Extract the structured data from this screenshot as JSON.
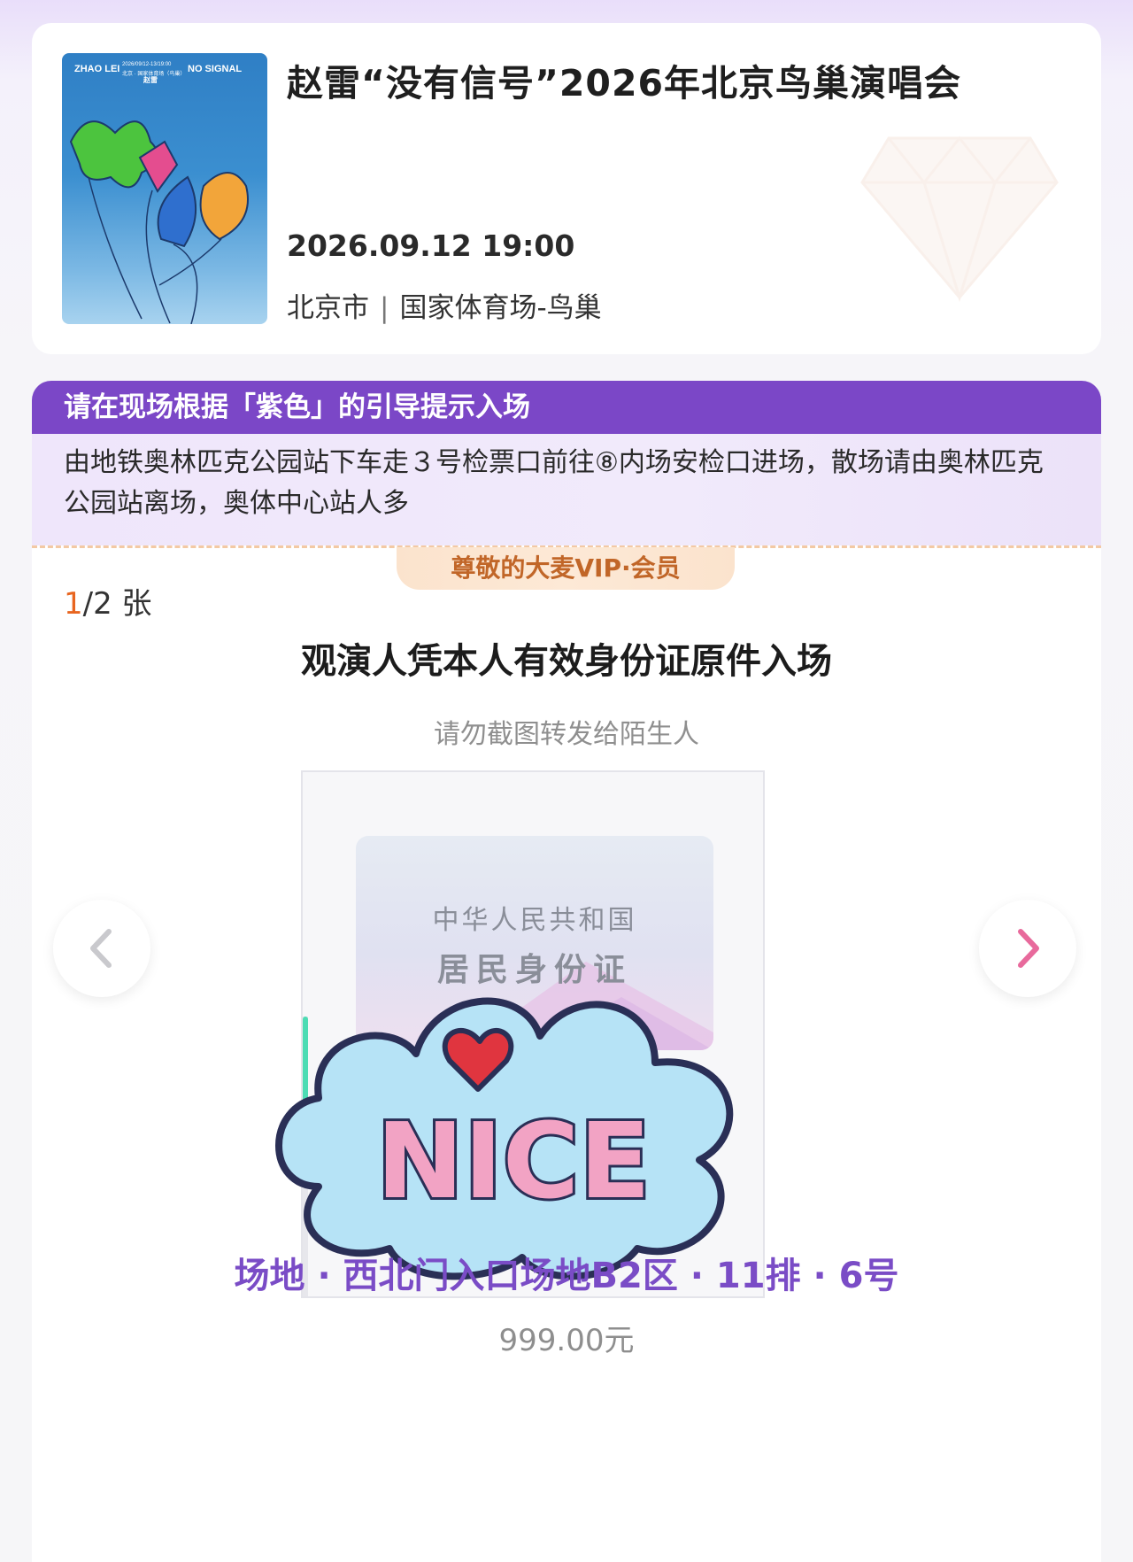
{
  "event": {
    "title": "赵雷“没有信号”2026年北京鸟巢演唱会",
    "datetime": "2026.09.12 19:00",
    "city": "北京市",
    "venue_separator": "|",
    "venue": "国家体育场-鸟巢",
    "poster": {
      "artist_en": "ZHAO LEI",
      "tour_en": "NO SIGNAL",
      "dates": "2026/09/12-13/19:00",
      "venue": "北京 · 国家体育场（鸟巢）",
      "artist_cn": "赵雷"
    }
  },
  "guide": {
    "header": "请在现场根据「紫色」的引导提示入场",
    "body": "由地铁奥林匹克公园站下车走３号检票口前往⑧内场安检口进场，散场请由奥林匹克公园站离场，奥体中心站人多"
  },
  "vip_badge": "尊敬的大麦VIP·会员",
  "ticket_count": {
    "current": "1",
    "total": "/2 张"
  },
  "ticket_notice": "观演人凭本人有效身份证原件入场",
  "screenshot_warning": "请勿截图转发给陌生人",
  "id_card": {
    "country": "中华人民共和国",
    "type": "居民身份证"
  },
  "refresh_progress": 0.35,
  "sticker_text": "NICE",
  "seat": "场地 · 西北门入口场地B2区 · 11排 · 6号",
  "price": "999.00元",
  "icons": {
    "prev": "chevron-left-icon",
    "next": "chevron-right-icon",
    "sticker": "nice-cloud-sticker"
  },
  "colors": {
    "accent_purple": "#7b47c7",
    "vip_orange": "#c16628",
    "progress_green": "#4cdcb4",
    "ticket_index": "#e8651f",
    "next_arrow": "#e86a9c"
  }
}
